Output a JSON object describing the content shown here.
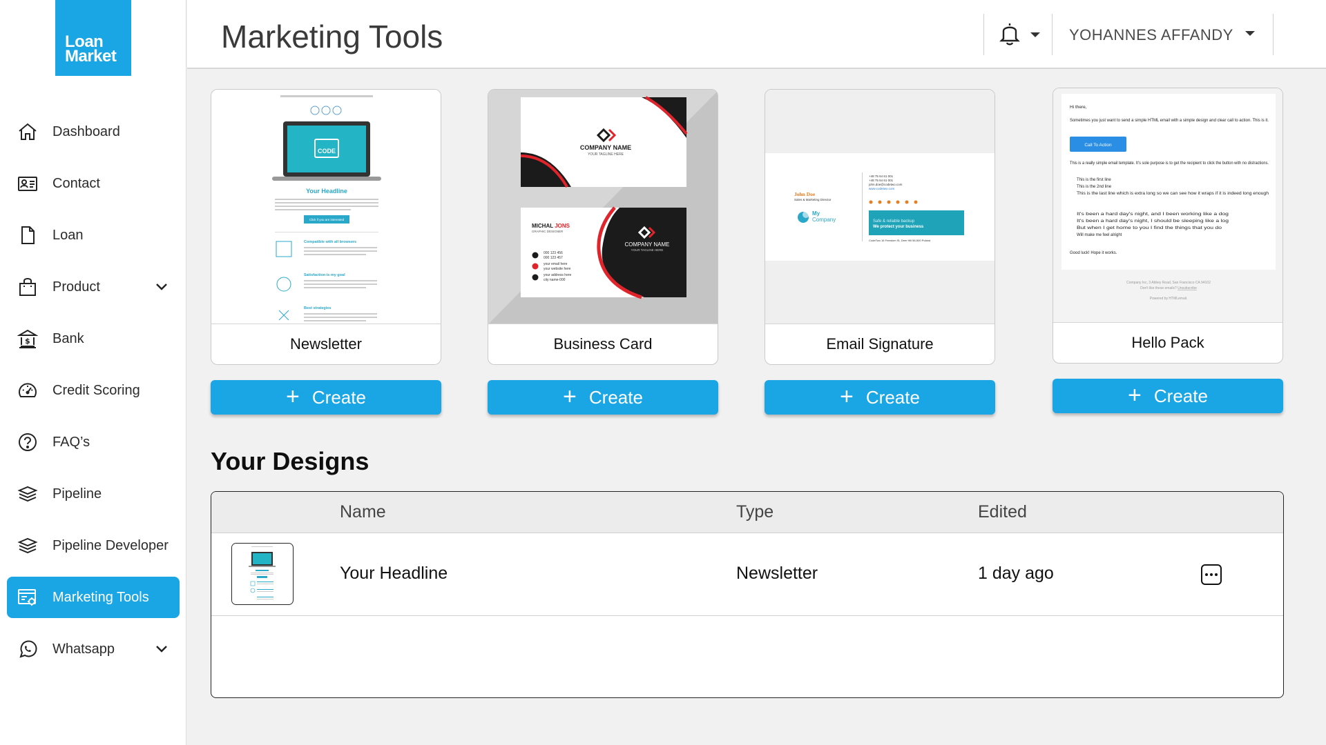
{
  "brand": {
    "logo_line1": "Loan",
    "logo_line2": "Market",
    "color": "#1aa6e4"
  },
  "sidebar": {
    "items": [
      {
        "label": "Dashboard",
        "icon": "home-icon"
      },
      {
        "label": "Contact",
        "icon": "contact-card-icon"
      },
      {
        "label": "Loan",
        "icon": "document-icon"
      },
      {
        "label": "Product",
        "icon": "shopping-bag-icon",
        "expandable": true
      },
      {
        "label": "Bank",
        "icon": "bank-icon"
      },
      {
        "label": "Credit Scoring",
        "icon": "gauge-icon"
      },
      {
        "label": "FAQ’s",
        "icon": "question-circle-icon"
      },
      {
        "label": "Pipeline",
        "icon": "layers-icon"
      },
      {
        "label": "Pipeline Developer",
        "icon": "layers-icon"
      },
      {
        "label": "Marketing Tools",
        "icon": "marketing-tools-icon",
        "active": true
      },
      {
        "label": "Whatsapp",
        "icon": "whatsapp-icon",
        "expandable": true
      }
    ]
  },
  "header": {
    "title": "Marketing Tools",
    "notifications_icon": "bell-icon",
    "user_name": "YOHANNES AFFANDY"
  },
  "templates": [
    {
      "label": "Newsletter",
      "button": "Create"
    },
    {
      "label": "Business Card",
      "button": "Create"
    },
    {
      "label": "Email Signature",
      "button": "Create"
    },
    {
      "label": "Hello Pack",
      "button": "Create"
    }
  ],
  "newsletter_preview": {
    "code_label": "CODE",
    "headline": "Your Headline",
    "cta": "Click if you are interested",
    "features": [
      "Compatible with all browsers",
      "Satisfaction is my goal",
      "Best strategies"
    ]
  },
  "business_card_preview": {
    "company": "COMPANY NAME",
    "tagline": "YOUR TAGLINE HERE",
    "person_first": "MICHAL",
    "person_last": "JONS",
    "role": "GRAPHIC DESIGNER",
    "phone1": "000 123 456",
    "phone2": "000 123 457",
    "email1": "your email here",
    "email2": "your website here",
    "address1": "your address here",
    "address2": "city name-000"
  },
  "signature_preview": {
    "name": "John Doe",
    "role": "Sales & Marketing Director",
    "company_word1": "My",
    "company_word2": "Company",
    "phone1": "+48 75 64 61 001",
    "phone2": "+48 75 64 61 001",
    "email": "john.doe@codetwo.com",
    "website": "www.codetwo.com",
    "banner1": "Safe & reliable backup",
    "banner2": "We protect your business",
    "address": "CodeTwo 16 Freedom St, Deer Hill 56-500 Poland"
  },
  "hello_pack_preview": {
    "greeting": "Hi there,",
    "intro": "Sometimes you just want to send a simple HTML email with a simple design and clear call to action. This is it.",
    "cta": "Call To Action",
    "body": "This is a really simple email template. It's sole purpose is to get the recipient to click the button with no distractions.",
    "bullets": [
      "This is the first line",
      "This is the 2nd line",
      "This is the last line which is extra long so we can see how it wraps if it is indeed long enough"
    ],
    "numbered": [
      "It's been a hard day's night, and I been working like a dog",
      "It's been a hard day's night, I should be sleeping like a log",
      "But when I get home to you I find the things that you do",
      "Will make me feel alright"
    ],
    "signoff": "Good luck! Hope it works.",
    "footer1": "Company Inc, 3 Abbey Road, San Francisco CA 94102",
    "footer2": "Don't like these emails?",
    "unsubscribe": "Unsubscribe",
    "powered": "Powered by HTMLemail."
  },
  "designs": {
    "title": "Your Designs",
    "columns": {
      "name": "Name",
      "type": "Type",
      "edited": "Edited"
    },
    "rows": [
      {
        "name": "Your Headline",
        "type": "Newsletter",
        "edited": "1 day ago"
      }
    ]
  }
}
